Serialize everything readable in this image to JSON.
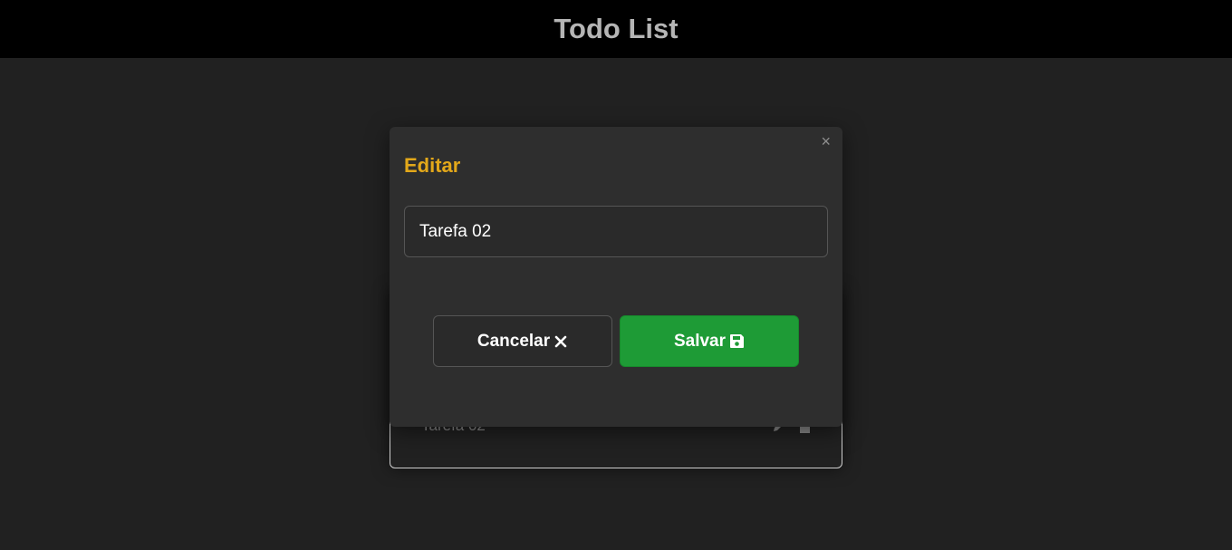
{
  "header": {
    "title": "Todo List"
  },
  "todos": [
    {
      "label": "Tarefa 02"
    }
  ],
  "modal": {
    "title": "Editar",
    "close_label": "×",
    "input_value": "Tarefa 02",
    "cancel_label": "Cancelar",
    "save_label": "Salvar"
  },
  "colors": {
    "header_bg": "#000000",
    "page_bg": "#212121",
    "modal_bg": "#2e2e2e",
    "accent": "#e3a81a",
    "save_green": "#1e9b36"
  },
  "icons": {
    "cancel": "x-icon",
    "save": "floppy-disk-icon",
    "edit": "pencil-icon",
    "delete": "trash-icon"
  }
}
